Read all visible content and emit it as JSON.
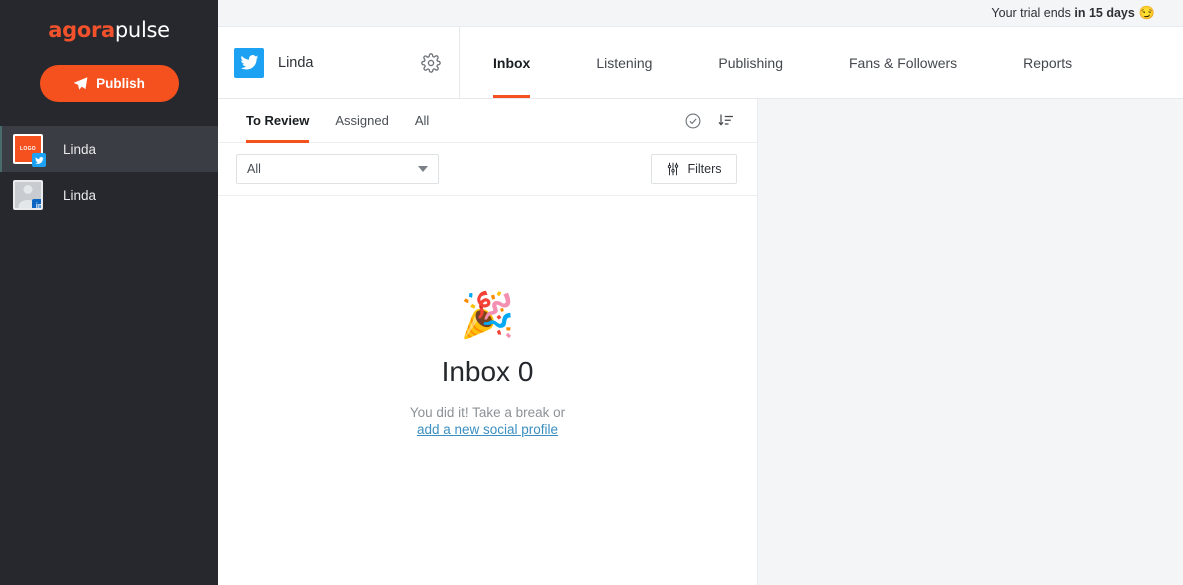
{
  "brand": {
    "logo_agora": "agora",
    "logo_pulse": "pulse",
    "accent_orange": "#f4511e",
    "sidebar_bg": "#26282e",
    "twitter_blue": "#1da1f2",
    "linkedin_blue": "#0a66c2",
    "link_blue": "#3a8fc0"
  },
  "sidebar": {
    "publish_label": "Publish",
    "publish_icon": "paper-plane-icon",
    "profiles": [
      {
        "name": "Linda",
        "network": "twitter",
        "avatar_type": "logo",
        "avatar_text": "LOGO",
        "active": true
      },
      {
        "name": "Linda",
        "network": "linkedin",
        "avatar_type": "person",
        "avatar_text": "in",
        "active": false
      }
    ]
  },
  "topbar": {
    "trial_prefix": "Your trial ends ",
    "trial_emphasis": "in 15 days",
    "trial_emoji": "😏"
  },
  "header": {
    "profile_name": "Linda",
    "profile_network_icon": "twitter-icon",
    "settings_icon": "gear-icon",
    "tabs": [
      {
        "label": "Inbox",
        "active": true
      },
      {
        "label": "Listening",
        "active": false
      },
      {
        "label": "Publishing",
        "active": false
      },
      {
        "label": "Fans & Followers",
        "active": false
      },
      {
        "label": "Reports",
        "active": false
      }
    ]
  },
  "inbox": {
    "subtabs": [
      {
        "label": "To Review",
        "active": true
      },
      {
        "label": "Assigned",
        "active": false
      },
      {
        "label": "All",
        "active": false
      }
    ],
    "actions": [
      {
        "icon": "check-circle-icon",
        "name": "mark-all-reviewed-icon"
      },
      {
        "icon": "sort-descending-icon",
        "name": "sort-icon"
      }
    ],
    "select_value": "All",
    "select_icon": "chevron-down-icon",
    "filters_label": "Filters",
    "filters_icon": "sliders-icon",
    "empty": {
      "emoji": "🎉",
      "emoji_name": "party-popper-icon",
      "title": "Inbox 0",
      "subtitle": "You did it! Take a break or",
      "link": "add a new social profile"
    }
  }
}
